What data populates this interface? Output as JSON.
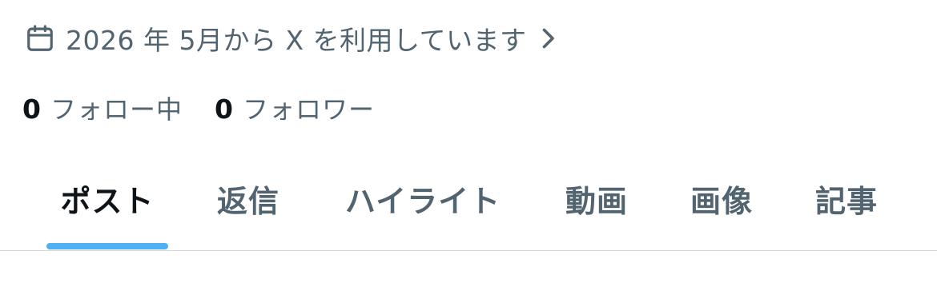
{
  "profile": {
    "joined_text": "2026 年 5月から X を利用しています",
    "joined_icon": "calendar-icon",
    "chevron_icon": "chevron-right-icon",
    "following": {
      "count": "0",
      "label": "フォロー中"
    },
    "followers": {
      "count": "0",
      "label": "フォロワー"
    }
  },
  "tabs": [
    {
      "label": "ポスト",
      "active": true
    },
    {
      "label": "返信",
      "active": false
    },
    {
      "label": "ハイライト",
      "active": false
    },
    {
      "label": "動画",
      "active": false
    },
    {
      "label": "画像",
      "active": false
    },
    {
      "label": "記事",
      "active": false
    }
  ],
  "colors": {
    "accent": "#1d9bf0",
    "text_primary": "#0f1419",
    "text_secondary": "#536471",
    "divider": "#cfd9de"
  }
}
